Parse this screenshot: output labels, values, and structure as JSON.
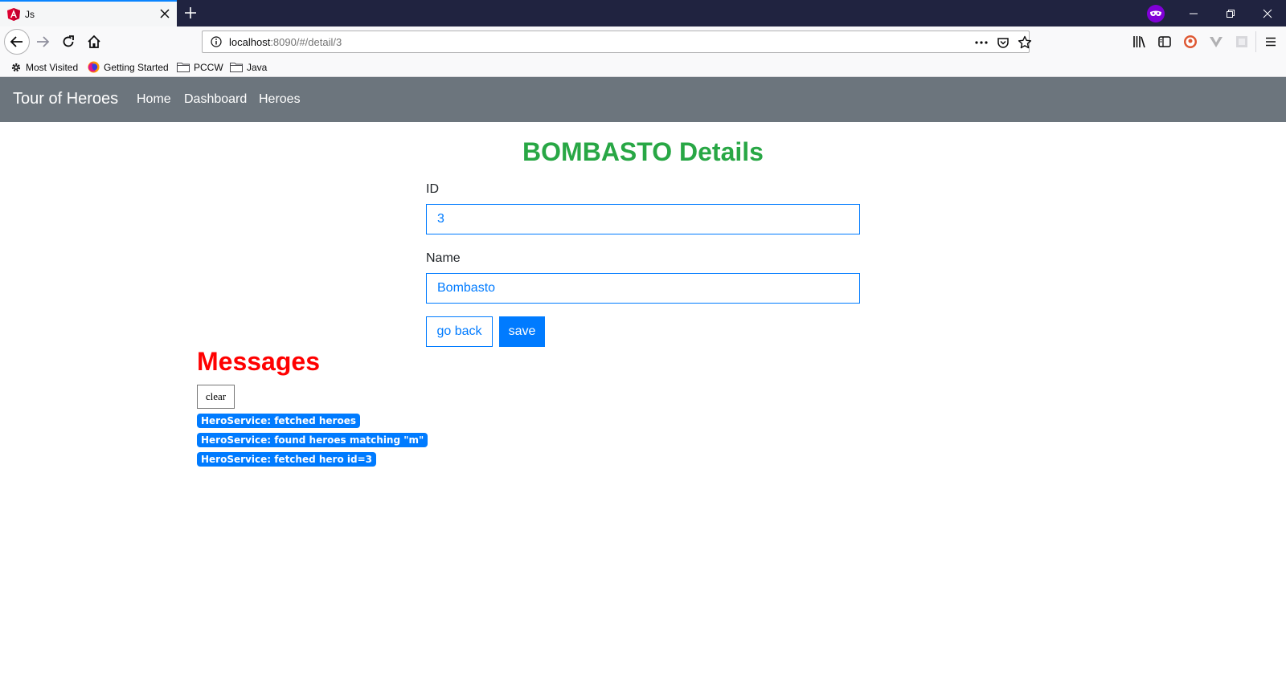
{
  "browser": {
    "tab_title": "Js",
    "url_host": "localhost",
    "url_rest": ":8090/#/detail/3",
    "bookmarks": [
      "Most Visited",
      "Getting Started",
      "PCCW",
      "Java"
    ]
  },
  "navbar": {
    "brand": "Tour of Heroes",
    "links": [
      "Home",
      "Dashboard",
      "Heroes"
    ]
  },
  "detail": {
    "title": "BOMBASTO Details",
    "id_label": "ID",
    "id_value": "3",
    "name_label": "Name",
    "name_value": "Bombasto",
    "back_label": "go back",
    "save_label": "save"
  },
  "messages": {
    "title": "Messages",
    "clear_label": "clear",
    "items": [
      "HeroService: fetched heroes",
      "HeroService: found heroes matching \"m\"",
      "HeroService: fetched hero id=3"
    ]
  },
  "colors": {
    "accent": "#007bff",
    "navbar": "#6c757d",
    "title_green": "#28a745",
    "messages_red": "#ff0000"
  }
}
